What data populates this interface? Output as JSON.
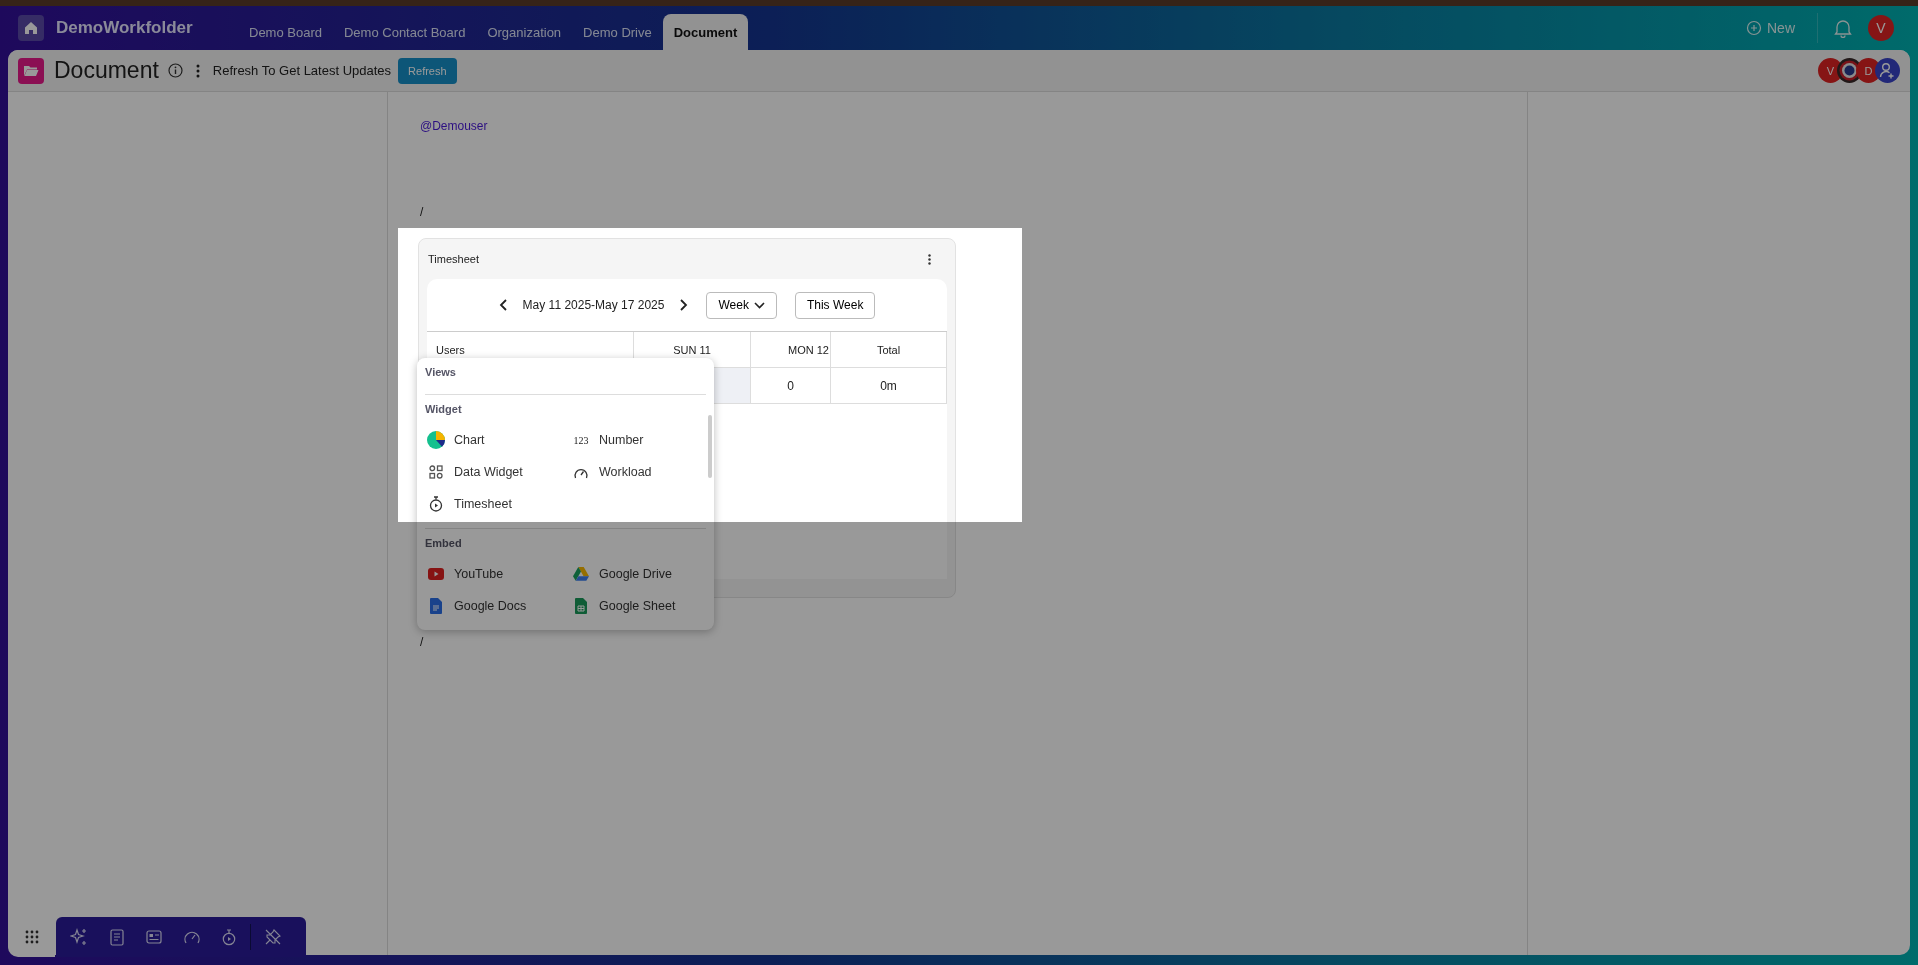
{
  "app": {
    "name": "DemoWorkfolder"
  },
  "nav_tabs": [
    {
      "label": "Demo Board",
      "selected": false
    },
    {
      "label": "Demo Contact Board",
      "selected": false
    },
    {
      "label": "Organization",
      "selected": false
    },
    {
      "label": "Demo Drive",
      "selected": false
    },
    {
      "label": "Document",
      "selected": true
    }
  ],
  "new_button": {
    "label": "New"
  },
  "user_avatar": {
    "initial": "V"
  },
  "document": {
    "title": "Document",
    "notice": "Refresh To Get Latest Updates",
    "refresh_button": "Refresh",
    "collaborators": [
      {
        "kind": "initial",
        "initial": "V"
      },
      {
        "kind": "picture"
      },
      {
        "kind": "initial",
        "initial": "D"
      }
    ]
  },
  "editor": {
    "mention": "@Demouser",
    "slash_before": "/",
    "slash_after": "/"
  },
  "timesheet": {
    "title": "Timesheet",
    "range": "May 11 2025-May 17 2025",
    "period": "Week",
    "this_week": "This Week",
    "columns": [
      "Users",
      "SUN 11",
      "MON 12",
      "Total"
    ],
    "row": [
      "0",
      "0m"
    ]
  },
  "insert_menu": {
    "sections": [
      {
        "title": "Views"
      },
      {
        "title": "Widget",
        "items": [
          {
            "kind": "chart",
            "label": "Chart"
          },
          {
            "kind": "number",
            "label": "Number",
            "glyph": "123"
          },
          {
            "kind": "data-widget",
            "label": "Data Widget"
          },
          {
            "kind": "workload",
            "label": "Workload"
          },
          {
            "kind": "timesheet",
            "label": "Timesheet"
          }
        ]
      },
      {
        "title": "Embed",
        "items": [
          {
            "kind": "youtube",
            "label": "YouTube"
          },
          {
            "kind": "google-drive",
            "label": "Google Drive"
          },
          {
            "kind": "google-docs",
            "label": "Google Docs"
          },
          {
            "kind": "google-sheet",
            "label": "Google Sheet"
          }
        ]
      }
    ]
  }
}
